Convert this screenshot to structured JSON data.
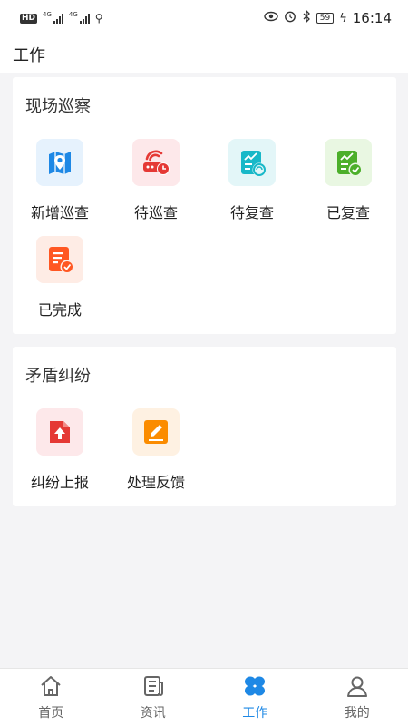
{
  "status_bar": {
    "network_left": "HD",
    "signal_1_tag": "4G",
    "signal_2_tag": "4G",
    "battery_level": "59",
    "time": "16:14"
  },
  "header": {
    "title": "工作"
  },
  "sections": [
    {
      "title": "现场巡察",
      "items": [
        {
          "label": "新增巡查",
          "icon": "map-pin-icon",
          "color": "#1e88e5",
          "bg": "#e6f2fd"
        },
        {
          "label": "待巡查",
          "icon": "router-clock-icon",
          "color": "#e53935",
          "bg": "#fde8ea"
        },
        {
          "label": "待复查",
          "icon": "report-refresh-icon",
          "color": "#19b8c8",
          "bg": "#e3f6f8"
        },
        {
          "label": "已复查",
          "icon": "report-check-icon",
          "color": "#4caf2a",
          "bg": "#e9f7e2"
        },
        {
          "label": "已完成",
          "icon": "doc-check-icon",
          "color": "#ff5722",
          "bg": "#feece5"
        }
      ]
    },
    {
      "title": "矛盾纠纷",
      "items": [
        {
          "label": "纠纷上报",
          "icon": "upload-file-icon",
          "color": "#e53935",
          "bg": "#fde8ea"
        },
        {
          "label": "处理反馈",
          "icon": "edit-pencil-icon",
          "color": "#fb8c00",
          "bg": "#fef1e2"
        }
      ]
    }
  ],
  "tabbar": {
    "tabs": [
      {
        "label": "首页",
        "icon": "home-icon",
        "active": false
      },
      {
        "label": "资讯",
        "icon": "news-icon",
        "active": false
      },
      {
        "label": "工作",
        "icon": "work-grid-icon",
        "active": true
      },
      {
        "label": "我的",
        "icon": "profile-icon",
        "active": false
      }
    ],
    "active_color": "#1e88e5",
    "inactive_color": "#666666"
  }
}
